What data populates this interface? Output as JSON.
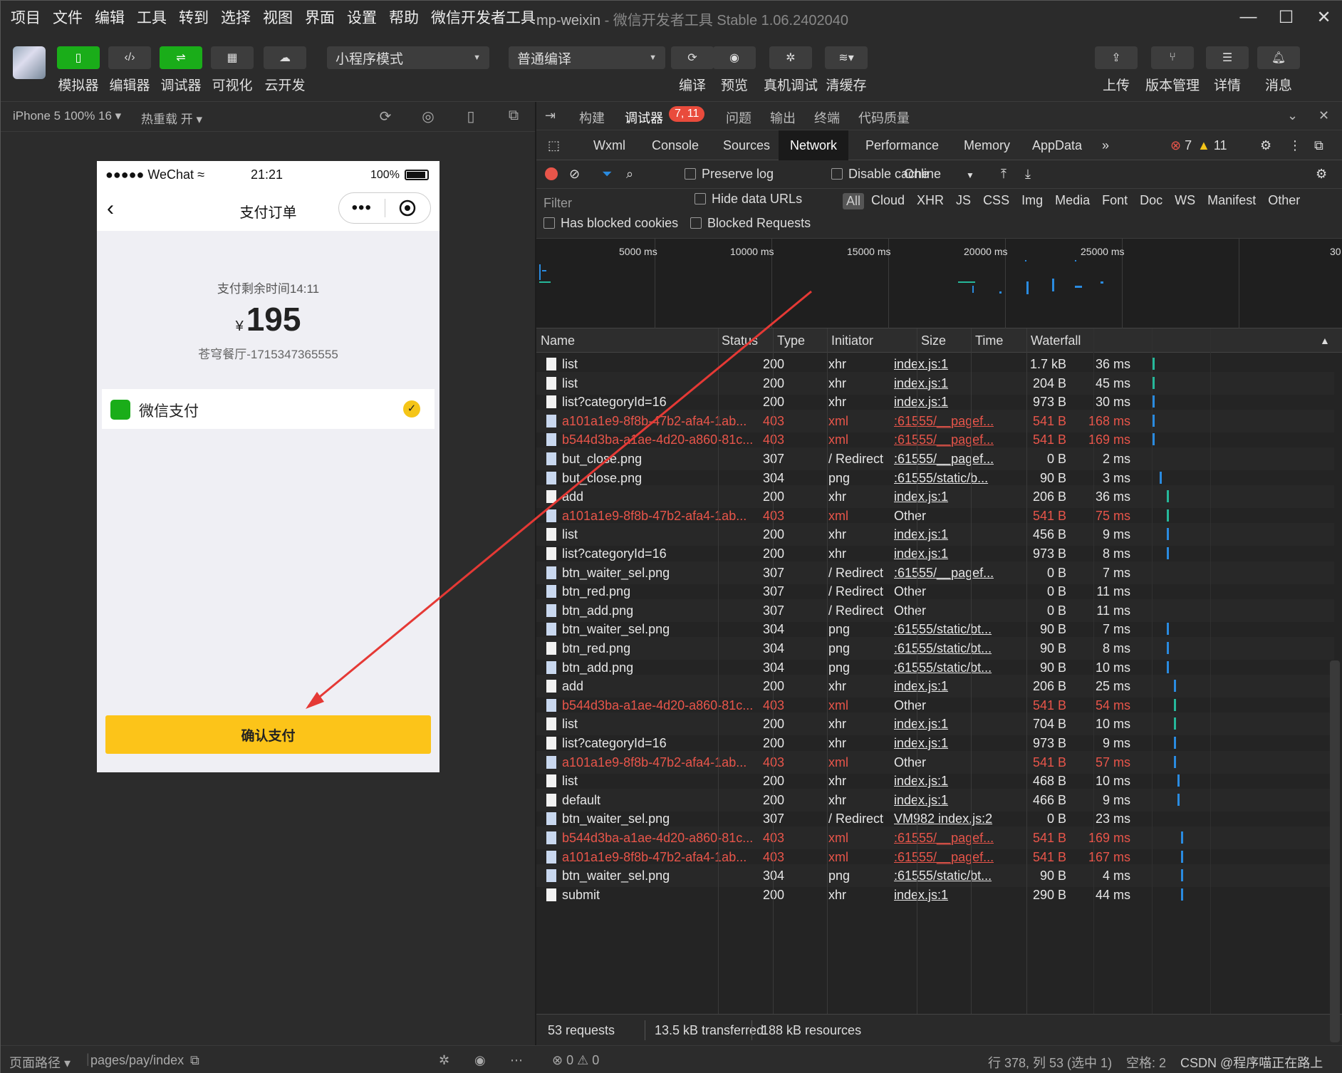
{
  "menubar": {
    "items": [
      "项目",
      "文件",
      "编辑",
      "工具",
      "转到",
      "选择",
      "视图",
      "界面",
      "设置",
      "帮助",
      "微信开发者工具"
    ],
    "window_title": "mp-weixin",
    "window_subtitle": " - 微信开发者工具 Stable 1.06.2402040"
  },
  "toolbar": {
    "left_buttons": [
      "模拟器",
      "编辑器",
      "调试器",
      "可视化",
      "云开发"
    ],
    "mode_select": "小程序模式",
    "compile_select": "普通编译",
    "mid_buttons": [
      "编译",
      "预览",
      "真机调试",
      "清缓存"
    ],
    "right_buttons": [
      "上传",
      "版本管理",
      "详情",
      "消息"
    ]
  },
  "simulator": {
    "device": "iPhone 5 100% 16",
    "hot_reload": "热重载 开",
    "phone": {
      "carrier": "●●●●● WeChat",
      "time": "21:21",
      "battery": "100%",
      "nav_title": "支付订单",
      "countdown": "支付剩余时间14:11",
      "currency": "¥",
      "amount": "195",
      "order_no": "苍穹餐厅-1715347365555",
      "pay_method": "微信支付",
      "confirm_label": "确认支付"
    }
  },
  "devtools": {
    "top_tabs": [
      "构建",
      "调试器",
      "问题",
      "输出",
      "终端",
      "代码质量"
    ],
    "top_badge": "7, 11",
    "panel_tabs": [
      "Wxml",
      "Console",
      "Sources",
      "Network",
      "Performance",
      "Memory",
      "AppData"
    ],
    "error_count": "7",
    "warn_count": "11",
    "network": {
      "preserve_log": "Preserve log",
      "disable_cache": "Disable cache",
      "throttle": "Online",
      "filter_placeholder": "Filter",
      "hide_data_urls": "Hide data URLs",
      "all": "All",
      "types": [
        "Cloud",
        "XHR",
        "JS",
        "CSS",
        "Img",
        "Media",
        "Font",
        "Doc",
        "WS",
        "Manifest",
        "Other"
      ],
      "has_blocked_cookies": "Has blocked cookies",
      "blocked_requests": "Blocked Requests",
      "overview_ticks": [
        "5000 ms",
        "10000 ms",
        "15000 ms",
        "20000 ms",
        "25000 ms",
        "30"
      ],
      "columns": [
        "Name",
        "Status",
        "Type",
        "Initiator",
        "Size",
        "Time",
        "Waterfall"
      ],
      "rows": [
        {
          "name": "list",
          "status": "200",
          "type": "xhr",
          "initiator": "index.js:1",
          "size": "1.7 kB",
          "time": "36 ms",
          "err": false,
          "img": false,
          "link": true,
          "wf": 1045,
          "wfc": "teal"
        },
        {
          "name": "list",
          "status": "200",
          "type": "xhr",
          "initiator": "index.js:1",
          "size": "204 B",
          "time": "45 ms",
          "err": false,
          "img": false,
          "link": true,
          "wf": 1045,
          "wfc": "teal"
        },
        {
          "name": "list?categoryId=16",
          "status": "200",
          "type": "xhr",
          "initiator": "index.js:1",
          "size": "973 B",
          "time": "30 ms",
          "err": false,
          "img": false,
          "link": true,
          "wf": 1045,
          "wfc": "blue"
        },
        {
          "name": "a101a1e9-8f8b-47b2-afa4-1ab...",
          "status": "403",
          "type": "xml",
          "initiator": ":61555/__pagef...",
          "size": "541 B",
          "time": "168 ms",
          "err": true,
          "img": true,
          "link": true,
          "wf": 1045,
          "wfc": "blue"
        },
        {
          "name": "b544d3ba-a1ae-4d20-a860-81c...",
          "status": "403",
          "type": "xml",
          "initiator": ":61555/__pagef...",
          "size": "541 B",
          "time": "169 ms",
          "err": true,
          "img": true,
          "link": true,
          "wf": 1045,
          "wfc": "blue"
        },
        {
          "name": "but_close.png",
          "status": "307",
          "type": "/ Redirect",
          "initiator": ":61555/__pagef...",
          "size": "0 B",
          "time": "2 ms",
          "err": false,
          "img": true,
          "link": true,
          "wf": 0,
          "wfc": "blue"
        },
        {
          "name": "but_close.png",
          "status": "304",
          "type": "png",
          "initiator": ":61555/static/b...",
          "size": "90 B",
          "time": "3 ms",
          "err": false,
          "img": true,
          "link": true,
          "wf": 1055,
          "wfc": "blue"
        },
        {
          "name": "add",
          "status": "200",
          "type": "xhr",
          "initiator": "index.js:1",
          "size": "206 B",
          "time": "36 ms",
          "err": false,
          "img": false,
          "link": true,
          "wf": 1065,
          "wfc": "teal"
        },
        {
          "name": "a101a1e9-8f8b-47b2-afa4-1ab...",
          "status": "403",
          "type": "xml",
          "initiator": "Other",
          "size": "541 B",
          "time": "75 ms",
          "err": true,
          "img": true,
          "link": false,
          "wf": 1065,
          "wfc": "teal"
        },
        {
          "name": "list",
          "status": "200",
          "type": "xhr",
          "initiator": "index.js:1",
          "size": "456 B",
          "time": "9 ms",
          "err": false,
          "img": false,
          "link": true,
          "wf": 1065,
          "wfc": "blue"
        },
        {
          "name": "list?categoryId=16",
          "status": "200",
          "type": "xhr",
          "initiator": "index.js:1",
          "size": "973 B",
          "time": "8 ms",
          "err": false,
          "img": false,
          "link": true,
          "wf": 1065,
          "wfc": "blue"
        },
        {
          "name": "btn_waiter_sel.png",
          "status": "307",
          "type": "/ Redirect",
          "initiator": ":61555/__pagef...",
          "size": "0 B",
          "time": "7 ms",
          "err": false,
          "img": true,
          "link": true,
          "wf": 0,
          "wfc": "blue"
        },
        {
          "name": "btn_red.png",
          "status": "307",
          "type": "/ Redirect",
          "initiator": "Other",
          "size": "0 B",
          "time": "11 ms",
          "err": false,
          "img": true,
          "link": false,
          "wf": 0,
          "wfc": "blue"
        },
        {
          "name": "btn_add.png",
          "status": "307",
          "type": "/ Redirect",
          "initiator": "Other",
          "size": "0 B",
          "time": "11 ms",
          "err": false,
          "img": true,
          "link": false,
          "wf": 0,
          "wfc": "blue"
        },
        {
          "name": "btn_waiter_sel.png",
          "status": "304",
          "type": "png",
          "initiator": ":61555/static/bt...",
          "size": "90 B",
          "time": "7 ms",
          "err": false,
          "img": true,
          "link": true,
          "wf": 1065,
          "wfc": "blue"
        },
        {
          "name": "btn_red.png",
          "status": "304",
          "type": "png",
          "initiator": ":61555/static/bt...",
          "size": "90 B",
          "time": "8 ms",
          "err": false,
          "img": false,
          "link": true,
          "wf": 1065,
          "wfc": "blue"
        },
        {
          "name": "btn_add.png",
          "status": "304",
          "type": "png",
          "initiator": ":61555/static/bt...",
          "size": "90 B",
          "time": "10 ms",
          "err": false,
          "img": true,
          "link": true,
          "wf": 1065,
          "wfc": "blue"
        },
        {
          "name": "add",
          "status": "200",
          "type": "xhr",
          "initiator": "index.js:1",
          "size": "206 B",
          "time": "25 ms",
          "err": false,
          "img": false,
          "link": true,
          "wf": 1075,
          "wfc": "blue"
        },
        {
          "name": "b544d3ba-a1ae-4d20-a860-81c...",
          "status": "403",
          "type": "xml",
          "initiator": "Other",
          "size": "541 B",
          "time": "54 ms",
          "err": true,
          "img": true,
          "link": false,
          "wf": 1075,
          "wfc": "teal"
        },
        {
          "name": "list",
          "status": "200",
          "type": "xhr",
          "initiator": "index.js:1",
          "size": "704 B",
          "time": "10 ms",
          "err": false,
          "img": false,
          "link": true,
          "wf": 1075,
          "wfc": "teal"
        },
        {
          "name": "list?categoryId=16",
          "status": "200",
          "type": "xhr",
          "initiator": "index.js:1",
          "size": "973 B",
          "time": "9 ms",
          "err": false,
          "img": false,
          "link": true,
          "wf": 1075,
          "wfc": "blue"
        },
        {
          "name": "a101a1e9-8f8b-47b2-afa4-1ab...",
          "status": "403",
          "type": "xml",
          "initiator": "Other",
          "size": "541 B",
          "time": "57 ms",
          "err": true,
          "img": true,
          "link": false,
          "wf": 1075,
          "wfc": "blue"
        },
        {
          "name": "list",
          "status": "200",
          "type": "xhr",
          "initiator": "index.js:1",
          "size": "468 B",
          "time": "10 ms",
          "err": false,
          "img": false,
          "link": true,
          "wf": 1080,
          "wfc": "blue"
        },
        {
          "name": "default",
          "status": "200",
          "type": "xhr",
          "initiator": "index.js:1",
          "size": "466 B",
          "time": "9 ms",
          "err": false,
          "img": false,
          "link": true,
          "wf": 1080,
          "wfc": "blue"
        },
        {
          "name": "btn_waiter_sel.png",
          "status": "307",
          "type": "/ Redirect",
          "initiator": "VM982 index.js:2",
          "size": "0 B",
          "time": "23 ms",
          "err": false,
          "img": true,
          "link": true,
          "wf": 0,
          "wfc": "blue"
        },
        {
          "name": "b544d3ba-a1ae-4d20-a860-81c...",
          "status": "403",
          "type": "xml",
          "initiator": ":61555/__pagef...",
          "size": "541 B",
          "time": "169 ms",
          "err": true,
          "img": true,
          "link": true,
          "wf": 1085,
          "wfc": "blue"
        },
        {
          "name": "a101a1e9-8f8b-47b2-afa4-1ab...",
          "status": "403",
          "type": "xml",
          "initiator": ":61555/__pagef...",
          "size": "541 B",
          "time": "167 ms",
          "err": true,
          "img": true,
          "link": true,
          "wf": 1085,
          "wfc": "blue"
        },
        {
          "name": "btn_waiter_sel.png",
          "status": "304",
          "type": "png",
          "initiator": ":61555/static/bt...",
          "size": "90 B",
          "time": "4 ms",
          "err": false,
          "img": true,
          "link": true,
          "wf": 1085,
          "wfc": "blue"
        },
        {
          "name": "submit",
          "status": "200",
          "type": "xhr",
          "initiator": "index.js:1",
          "size": "290 B",
          "time": "44 ms",
          "err": false,
          "img": false,
          "link": true,
          "wf": 1085,
          "wfc": "blue"
        }
      ],
      "summary": [
        "53 requests",
        "13.5 kB transferred",
        "188 kB resources"
      ]
    }
  },
  "statusbar": {
    "page_path_label": "页面路径",
    "page_path": "pages/pay/index",
    "errors": "0",
    "warnings": "0",
    "cursor": "行 378, 列 53 (选中 1)",
    "indent": "空格: 2",
    "watermark": "CSDN @程序喵正在路上"
  },
  "colors": {
    "accent_green": "#1aad19",
    "error_red": "#e8554a",
    "confirm_yellow": "#fcc419",
    "annotation_arrow": "#e53935"
  }
}
